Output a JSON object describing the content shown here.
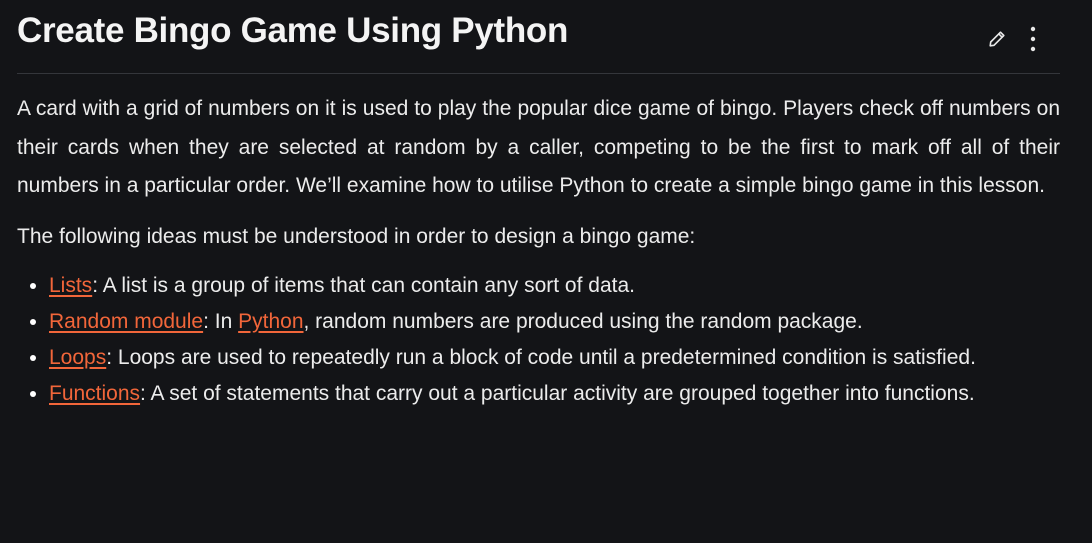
{
  "article": {
    "title": "Create Bingo Game Using Python",
    "intro": "A card with a grid of numbers on it is used to play the popular dice game of bingo. Players check off numbers on their cards when they are selected at random by a caller, competing to be the first to mark off all of their numbers in a particular order. We’ll examine how to utilise Python to create a simple bingo game in this lesson.",
    "ideas_intro": "The following ideas must be understood in order to design a bingo game:",
    "concepts": [
      {
        "link": "Lists",
        "text": ": A list is a group of items that can contain any sort of data."
      },
      {
        "link": "Random module",
        "mid": ": In ",
        "link2": "Python",
        "text": ", random numbers are produced using the random package."
      },
      {
        "link": "Loops",
        "text": ": Loops are used to repeatedly run a block of code until a predetermined condition is satisfied."
      },
      {
        "link": "Functions",
        "text": ": A set of statements that carry out a particular activity are grouped together into functions."
      }
    ]
  },
  "icons": {
    "edit": "pencil-icon",
    "more": "more-vertical-icon"
  },
  "colors": {
    "background": "#131417",
    "text": "#ececec",
    "link": "#f2663a",
    "divider": "#34363b"
  }
}
